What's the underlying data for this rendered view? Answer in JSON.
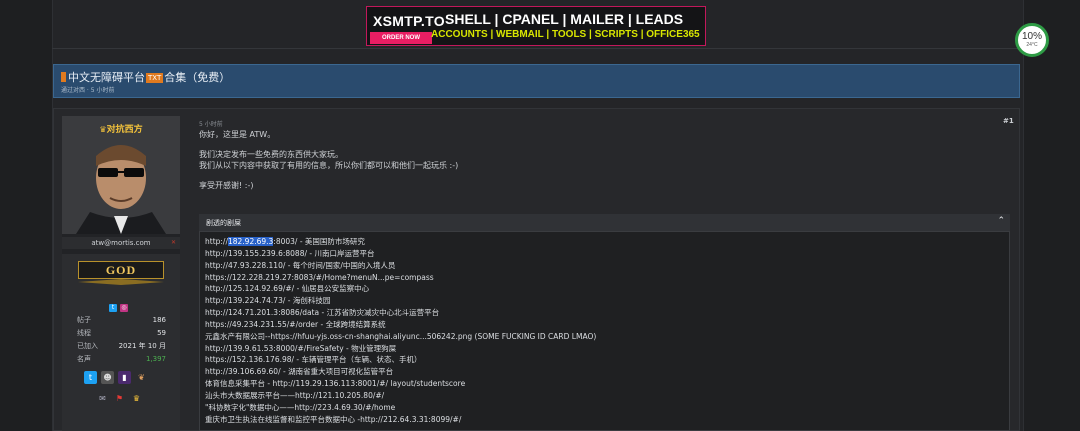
{
  "banner": {
    "brand": "XSMTP.TO",
    "order": "ORDER NOW",
    "headline": "SHELL | CPANEL | MAILER | LEADS",
    "sub": "ACCOUNTS | WEBMAIL | TOOLS | SCRIPTS | OFFICE365",
    "border_color": "#c2185b",
    "sub_color": "#d8e600"
  },
  "widget": {
    "percent": "10%",
    "temp": "24°C"
  },
  "thread": {
    "title_before": "中文无障碍平台",
    "tag": "TXT",
    "title_after": "合集（免费）",
    "meta": "通过对西 · 5 小时前"
  },
  "user": {
    "display_name": "对抗西方",
    "email": "atw@mortis.com",
    "rank": "GOD",
    "stats": [
      {
        "label": "帖子",
        "value": "186"
      },
      {
        "label": "线程",
        "value": "59"
      },
      {
        "label": "已加入",
        "value": "2021 年 10 月"
      },
      {
        "label": "名声",
        "value": "1,397"
      }
    ]
  },
  "post": {
    "time": "5 小时前",
    "number": "#1",
    "greeting": "你好，这里是 ATW。",
    "para1": "我们决定发布一些免费的东西供大家玩。",
    "para2": "我们从以下内容中获取了有用的信息，所以你们都可以和他们一起玩乐 :-)",
    "closing": "享受开感谢! :-)"
  },
  "spoiler": {
    "label": "剧透的剧屎",
    "first_prefix": "http://",
    "first_highlight": "182.92.69.3",
    "first_suffix": ":8003/ - 美国国防市场研究",
    "lines": [
      "http://139.155.239.6:8088/ - 川南口岸运营平台",
      "http://47.93.228.110/ - 每个时间/国家/中国的入境人员",
      "https://122.228.219.27:8083/#/Home?menuN...pe=compass",
      "http://125.124.92.69/#/ - 仙居县公安监察中心",
      "http://139.224.74.73/ - 海创科技园",
      "http://124.71.201.3:8086/data - 江苏省防灾减灾中心北斗运营平台",
      "https://49.234.231.55/#/order - 全球跨境结算系统",
      "元鑫水产有限公司--https://hfuu-yjs.oss-cn-shanghai.aliyunc...506242.png (SOME FUCKING ID CARD LMAO)",
      "http://139.9.61.53:8000/#/FireSafety - 物业管理狗屎",
      "https://152.136.176.98/ - 车辆管理平台（车辆、状态、手机）",
      "http://39.106.69.60/ - 湖南省重大项目可视化监管平台",
      "体育信息采集平台 - http://119.29.136.113:8001/#/ layout/studentscore",
      "汕头市大数据展示平台——http://121.10.205.80/#/",
      "\"科协数字化\"数据中心——http://223.4.69.30/#/home",
      "重庆市卫生执法在线监督和监控平台数据中心 -http://212.64.3.31:8099/#/"
    ]
  }
}
